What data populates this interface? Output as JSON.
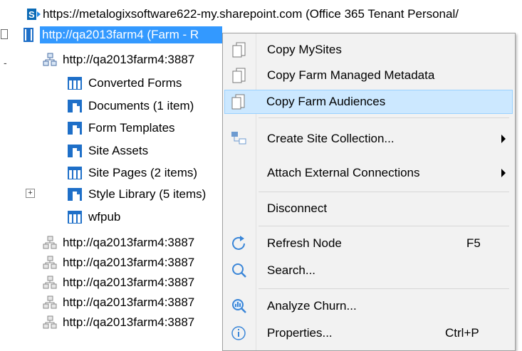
{
  "tree": {
    "root_url": "https://metalogixsoftware622-my.sharepoint.com (Office 365 Tenant Personal/",
    "farm_node": "http://qa2013farm4 (Farm - R",
    "site_node": "http://qa2013farm4:3887",
    "children": [
      {
        "label": "Converted Forms",
        "icon": "list-icon"
      },
      {
        "label": "Documents (1 item)",
        "icon": "library-icon"
      },
      {
        "label": "Form Templates",
        "icon": "library-icon"
      },
      {
        "label": "Site Assets",
        "icon": "library-icon"
      },
      {
        "label": "Site Pages (2 items)",
        "icon": "list-icon"
      },
      {
        "label": "Style Library (5 items)",
        "icon": "library-icon"
      },
      {
        "label": "wfpub",
        "icon": "list-icon"
      }
    ],
    "sibling_sites": [
      "http://qa2013farm4:3887",
      "http://qa2013farm4:3887",
      "http://qa2013farm4:3887",
      "http://qa2013farm4:3887",
      "http://qa2013farm4:3887"
    ],
    "expander_collapsed": "-",
    "expander_expand": "+"
  },
  "menu": {
    "items": [
      {
        "label": "Copy MySites"
      },
      {
        "label": "Copy Farm Managed Metadata"
      },
      {
        "label": "Copy Farm Audiences"
      },
      {
        "label": "Create Site Collection..."
      },
      {
        "label": "Attach External Connections"
      },
      {
        "label": "Disconnect"
      },
      {
        "label": "Refresh Node",
        "shortcut": "F5"
      },
      {
        "label": "Search..."
      },
      {
        "label": "Analyze Churn..."
      },
      {
        "label": "Properties...",
        "shortcut": "Ctrl+P"
      }
    ]
  },
  "colors": {
    "selection": "#3399ff",
    "menu_highlight": "#cce8ff",
    "icon_blue": "#1e6fc8"
  }
}
